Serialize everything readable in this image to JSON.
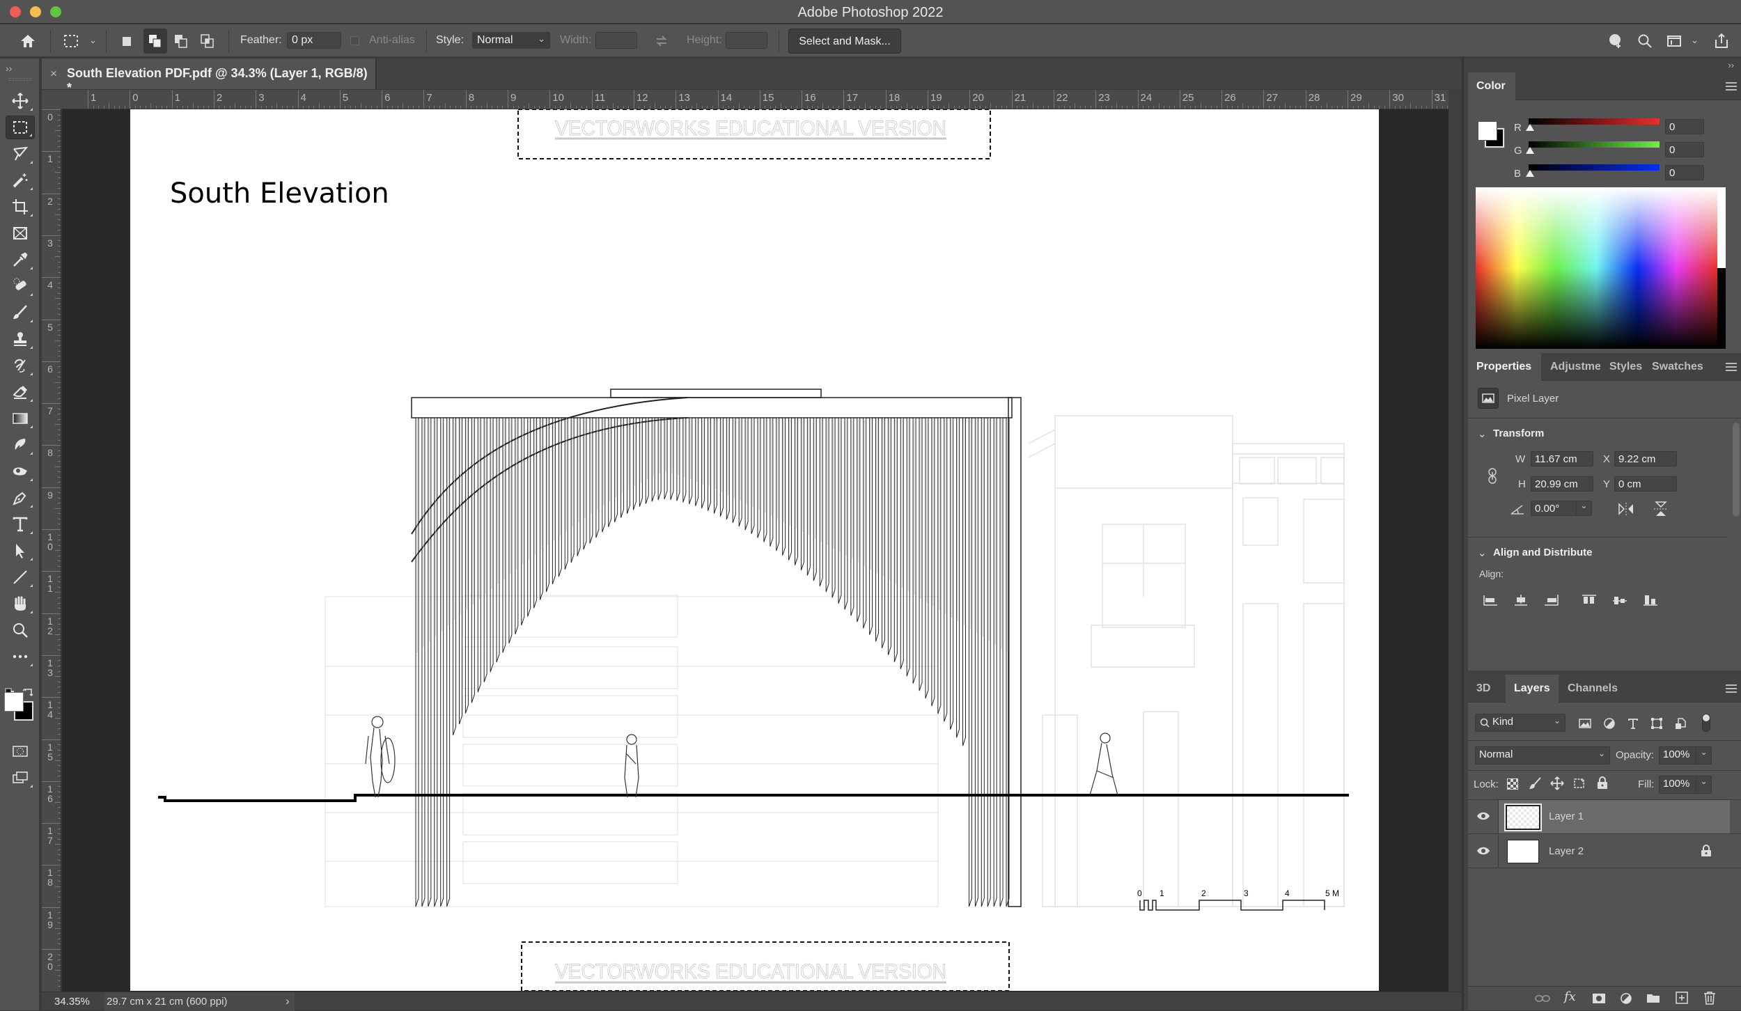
{
  "app": {
    "title": "Adobe Photoshop 2022",
    "traffic_colors": {
      "close": "#ee5e56",
      "minimize": "#f5bd4f",
      "maximize": "#5ec640"
    }
  },
  "options_bar": {
    "feather_label": "Feather:",
    "feather_value": "0 px",
    "anti_alias_label": "Anti-alias",
    "style_label": "Style:",
    "style_value": "Normal",
    "width_label": "Width:",
    "width_value": "",
    "height_label": "Height:",
    "height_value": "",
    "select_and_mask_label": "Select and Mask...",
    "icons": [
      "home-icon",
      "marquee-preset-icon",
      "new-selection-icon",
      "add-to-selection-icon",
      "subtract-from-selection-icon",
      "intersect-selection-icon",
      "swap-icon",
      "learn-icon",
      "search-icon",
      "workspace-icon",
      "share-icon"
    ]
  },
  "document": {
    "tab_title": "South Elevation PDF.pdf @ 34.3% (Layer 1, RGB/8) *",
    "close_glyph": "×",
    "h_ruler_labels": [
      "1",
      "0",
      "1",
      "2",
      "3",
      "4",
      "5",
      "6",
      "7",
      "8",
      "9",
      "10",
      "11",
      "12",
      "13",
      "14",
      "15",
      "16",
      "17",
      "18",
      "19",
      "20",
      "21",
      "22",
      "23",
      "24",
      "25",
      "26",
      "27",
      "28",
      "29",
      "30",
      "31"
    ],
    "v_ruler_labels": [
      "0",
      "1",
      "2",
      "3",
      "4",
      "5",
      "6",
      "7",
      "8",
      "9",
      "10",
      "11",
      "12",
      "13",
      "14",
      "15",
      "16",
      "17",
      "18",
      "19",
      "20"
    ]
  },
  "drawing": {
    "title": "South Elevation",
    "watermark_text": "VECTORWORKS EDUCATIONAL VERSION",
    "scale_bar_labels": [
      "0",
      "1",
      "2",
      "3",
      "4",
      "5 M"
    ]
  },
  "tools": [
    {
      "name": "move-tool",
      "icon": "move-icon"
    },
    {
      "name": "rectangular-marquee-tool",
      "icon": "marquee-icon",
      "active": true
    },
    {
      "name": "lasso-tool",
      "icon": "lasso-icon"
    },
    {
      "name": "magic-wand-tool",
      "icon": "magic-wand-icon"
    },
    {
      "name": "crop-tool",
      "icon": "crop-icon"
    },
    {
      "name": "frame-tool",
      "icon": "frame-icon"
    },
    {
      "name": "eyedropper-tool",
      "icon": "eyedropper-icon"
    },
    {
      "name": "healing-brush-tool",
      "icon": "bandage-icon"
    },
    {
      "name": "brush-tool",
      "icon": "brush-icon"
    },
    {
      "name": "clone-stamp-tool",
      "icon": "stamp-icon"
    },
    {
      "name": "history-brush-tool",
      "icon": "history-brush-icon"
    },
    {
      "name": "eraser-tool",
      "icon": "eraser-icon"
    },
    {
      "name": "gradient-tool",
      "icon": "gradient-icon"
    },
    {
      "name": "blur-tool",
      "icon": "blur-icon"
    },
    {
      "name": "dodge-tool",
      "icon": "dodge-icon"
    },
    {
      "name": "pen-tool",
      "icon": "pen-icon"
    },
    {
      "name": "type-tool",
      "icon": "type-icon"
    },
    {
      "name": "path-selection-tool",
      "icon": "arrow-icon"
    },
    {
      "name": "line-tool",
      "icon": "line-icon"
    },
    {
      "name": "hand-tool",
      "icon": "hand-icon"
    },
    {
      "name": "zoom-tool",
      "icon": "zoom-icon"
    },
    {
      "name": "edit-toolbar",
      "icon": "more-icon"
    }
  ],
  "colors": {
    "foreground": "#ffffff",
    "background": "#000000"
  },
  "color_panel": {
    "tab": "Color",
    "channels": [
      {
        "label": "R",
        "value": "0",
        "gradient_end": "#e8302a"
      },
      {
        "label": "G",
        "value": "0",
        "gradient_end": "#6ef04a"
      },
      {
        "label": "B",
        "value": "0",
        "gradient_end": "#0a2cf5"
      }
    ]
  },
  "properties_panel": {
    "tabs": [
      "Properties",
      "Adjustme",
      "Styles",
      "Swatches"
    ],
    "active_tab": 0,
    "layer_type": "Pixel Layer",
    "transform": {
      "header": "Transform",
      "w_label": "W",
      "w_value": "11.67 cm",
      "h_label": "H",
      "h_value": "20.99 cm",
      "x_label": "X",
      "x_value": "9.22 cm",
      "y_label": "Y",
      "y_value": "0 cm",
      "angle_value": "0.00°"
    },
    "align": {
      "header": "Align and Distribute",
      "align_label": "Align:"
    }
  },
  "layers_panel": {
    "tabs": [
      "3D",
      "Layers",
      "Channels"
    ],
    "active_tab": 1,
    "filter_kind": "Kind",
    "blend_mode": "Normal",
    "opacity_label": "Opacity:",
    "opacity_value": "100%",
    "lock_label": "Lock:",
    "fill_label": "Fill:",
    "fill_value": "100%",
    "layers": [
      {
        "name": "Layer 1",
        "visible": true,
        "selected": true,
        "locked": false
      },
      {
        "name": "Layer 2",
        "visible": true,
        "selected": false,
        "locked": true
      }
    ]
  },
  "status_bar": {
    "zoom": "34.35%",
    "doc_info": "29.7 cm x 21 cm (600 ppi)",
    "arrow": "›"
  }
}
